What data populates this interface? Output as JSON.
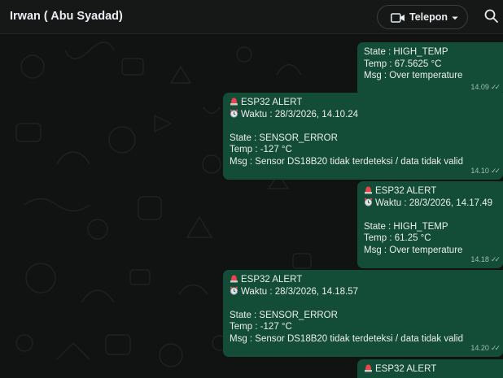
{
  "header": {
    "contact_name": "Irwan ( Abu Syadad)",
    "call_label": "Telepon"
  },
  "messages": [
    {
      "id": "m1",
      "has_alert": false,
      "alert_title": "",
      "waktu": "",
      "state": "State : HIGH_TEMP",
      "temp": "Temp : 67.5625 °C",
      "msg": "Msg  : Over temperature",
      "time": "14.09"
    },
    {
      "id": "m2",
      "has_alert": true,
      "alert_title": "ESP32 ALERT",
      "waktu": "Waktu : 28/3/2026, 14.10.24",
      "state": "State : SENSOR_ERROR",
      "temp": "Temp : -127 °C",
      "msg": "Msg  : Sensor DS18B20 tidak terdeteksi / data tidak valid",
      "time": "14.10"
    },
    {
      "id": "m3",
      "has_alert": true,
      "alert_title": "ESP32 ALERT",
      "waktu": "Waktu : 28/3/2026, 14.17.49",
      "state": "State : HIGH_TEMP",
      "temp": "Temp : 61.25 °C",
      "msg": "Msg  : Over temperature",
      "time": "14.18"
    },
    {
      "id": "m4",
      "has_alert": true,
      "alert_title": "ESP32 ALERT",
      "waktu": "Waktu : 28/3/2026, 14.18.57",
      "state": "State : SENSOR_ERROR",
      "temp": "Temp : -127 °C",
      "msg": "Msg  : Sensor DS18B20 tidak terdeteksi / data tidak valid",
      "time": "14.20"
    },
    {
      "id": "m5",
      "has_alert": true,
      "alert_title": "ESP32 ALERT",
      "waktu": "",
      "state": "",
      "temp": "",
      "msg": "",
      "time": ""
    }
  ],
  "colors": {
    "header_bg": "#161717",
    "chat_bg": "#111313",
    "bubble_out": "#144d37",
    "text": "#e9edef",
    "tick_read": "#9fbfae"
  },
  "icons": {
    "video_call": "video-camera-icon",
    "dropdown": "chevron-down-icon",
    "search": "search-icon",
    "alert": "police-light-icon",
    "clock": "alarm-clock-icon",
    "read": "double-check-icon"
  }
}
